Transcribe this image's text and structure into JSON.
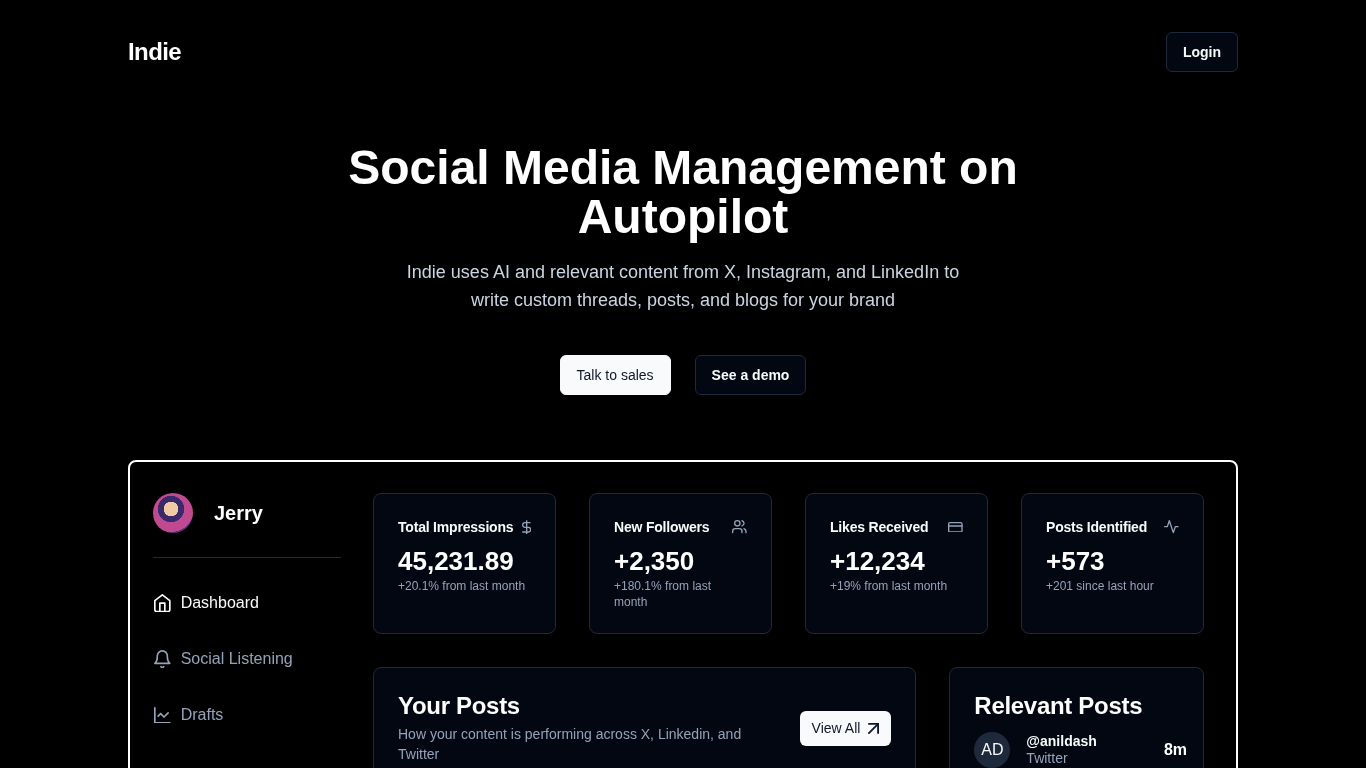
{
  "header": {
    "logo": "Indie",
    "login": "Login"
  },
  "hero": {
    "title": "Social Media Management on Autopilot",
    "subtitle": "Indie uses AI and relevant content from X, Instagram, and LinkedIn to write custom threads, posts, and blogs for your brand",
    "buttons": [
      {
        "label": "Talk to sales",
        "kind": "primary"
      },
      {
        "label": "See a demo",
        "kind": "secondary"
      }
    ]
  },
  "dashboard": {
    "user": {
      "name": "Jerry"
    },
    "nav": [
      {
        "label": "Dashboard",
        "selected": true
      },
      {
        "label": "Social Listening",
        "selected": false
      },
      {
        "label": "Drafts",
        "selected": false
      }
    ],
    "stats": [
      {
        "title": "Total Impressions",
        "value": "45,231.89",
        "change": "+20.1% from last month"
      },
      {
        "title": "New Followers",
        "value": "+2,350",
        "change": "+180.1% from last month"
      },
      {
        "title": "Likes Received",
        "value": "+12,234",
        "change": "+19% from last month"
      },
      {
        "title": "Posts Identified",
        "value": "+573",
        "change": "+201 since last hour"
      }
    ],
    "your_posts": {
      "title": "Your Posts",
      "description": "How your content is performing across X, Linkedin, and Twitter",
      "button": "View All"
    },
    "relevant_posts": {
      "title": "Relevant Posts",
      "items": [
        {
          "initials": "AD",
          "handle": "@anildash",
          "source": "Twitter",
          "time": "8m"
        }
      ]
    }
  }
}
